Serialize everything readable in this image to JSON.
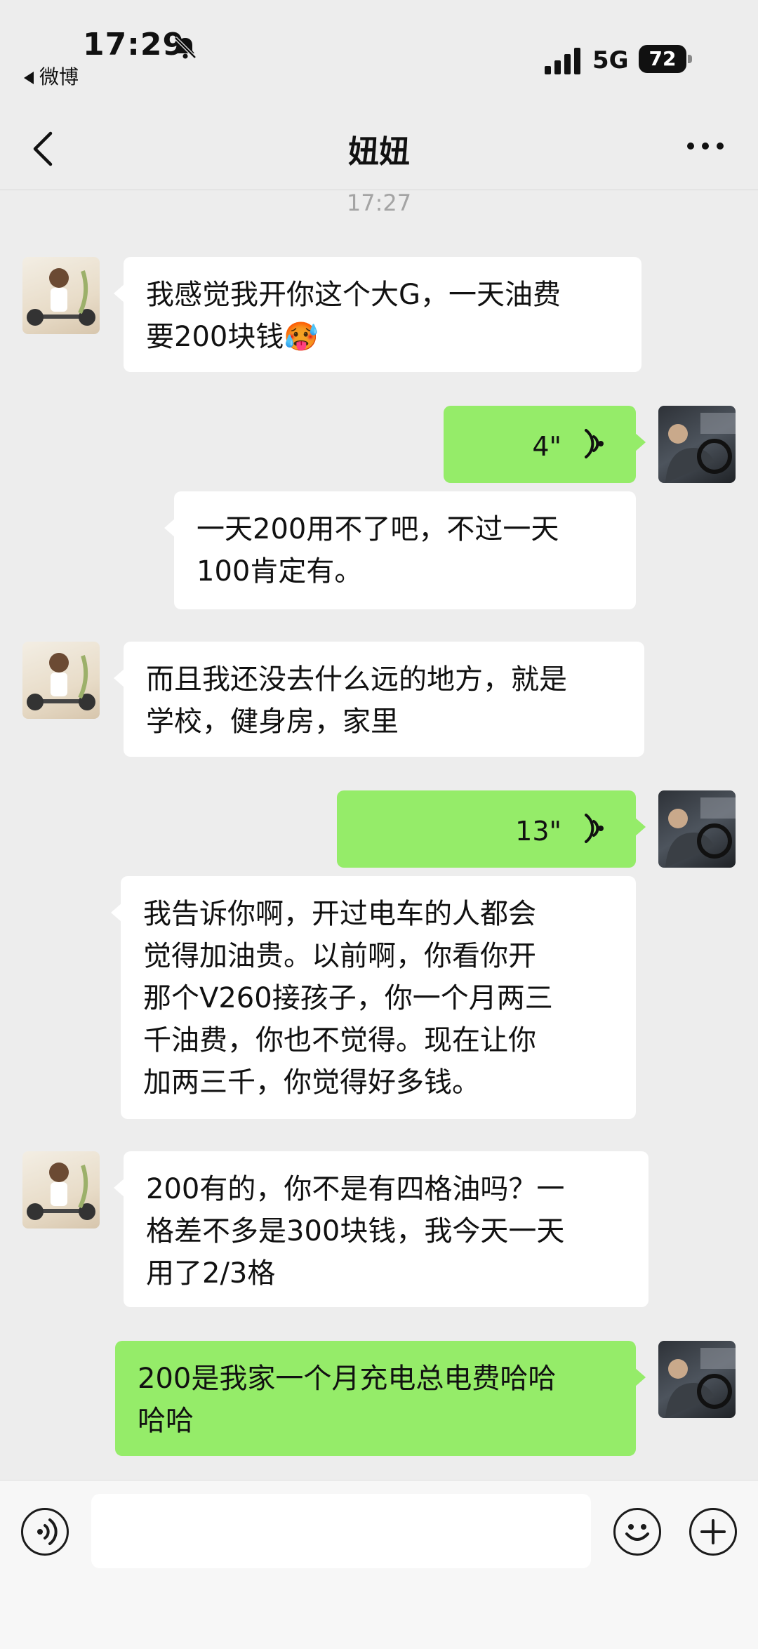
{
  "status_bar": {
    "time": "17:29",
    "back_app": "微博",
    "network": "5G",
    "battery": "72"
  },
  "header": {
    "title": "妞妞"
  },
  "timestamp": "17:27",
  "messages": [
    {
      "side": "in",
      "type": "text",
      "text_lines": [
        "我感觉我开你这个大G，一天油费",
        "要200块钱🥵"
      ]
    },
    {
      "side": "out",
      "type": "voice",
      "duration": "4\""
    },
    {
      "side": "transcript",
      "type": "text",
      "text_lines": [
        "一天200用不了吧，不过一天",
        "100肯定有。"
      ]
    },
    {
      "side": "in",
      "type": "text",
      "text_lines": [
        "而且我还没去什么远的地方，就是",
        "学校，健身房，家里"
      ]
    },
    {
      "side": "out",
      "type": "voice",
      "duration": "13\""
    },
    {
      "side": "transcript",
      "type": "text",
      "text_lines": [
        "我告诉你啊，开过电车的人都会",
        "觉得加油贵。以前啊，你看你开",
        "那个V260接孩子，你一个月两三",
        "千油费，你也不觉得。现在让你",
        "加两三千，你觉得好多钱。"
      ]
    },
    {
      "side": "in",
      "type": "text",
      "text_lines": [
        "200有的，你不是有四格油吗？一",
        "格差不多是300块钱，我今天一天",
        "用了2/3格"
      ]
    },
    {
      "side": "out",
      "type": "text",
      "text_lines": [
        "200是我家一个月充电总电费哈哈",
        "哈哈"
      ]
    }
  ],
  "input_bar": {
    "text": ""
  },
  "colors": {
    "background": "#ededed",
    "out_bubble": "#95ec69",
    "in_bubble": "#ffffff"
  }
}
